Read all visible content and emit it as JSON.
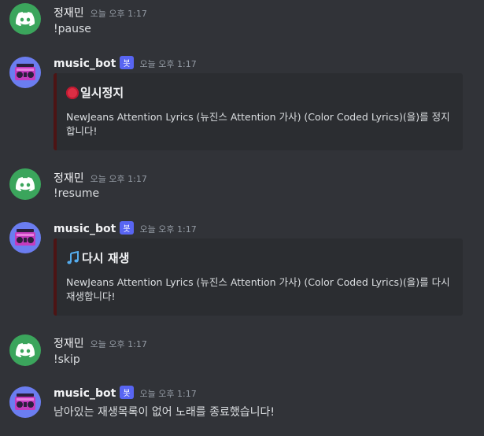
{
  "messages": [
    {
      "username": "정재민",
      "timestamp": "오늘 오후 1:17",
      "content": "!pause"
    },
    {
      "username": "music_bot",
      "bot_tag": "봇",
      "timestamp": "오늘 오후 1:17",
      "embed": {
        "title": "일시정지",
        "description": "NewJeans Attention Lyrics (뉴진스 Attention 가사) (Color Coded Lyrics)(을)를 정지합니다!"
      }
    },
    {
      "username": "정재민",
      "timestamp": "오늘 오후 1:17",
      "content": "!resume"
    },
    {
      "username": "music_bot",
      "bot_tag": "봇",
      "timestamp": "오늘 오후 1:17",
      "embed": {
        "title": "다시 재생",
        "description": "NewJeans Attention Lyrics (뉴진스 Attention 가사) (Color Coded Lyrics)(을)를 다시 재생합니다!"
      }
    },
    {
      "username": "정재민",
      "timestamp": "오늘 오후 1:17",
      "content": "!skip"
    },
    {
      "username": "music_bot",
      "bot_tag": "봇",
      "timestamp": "오늘 오후 1:17",
      "content": "남아있는 재생목록이 없어 노래를 종료했습니다!"
    }
  ],
  "colors": {
    "background": "#313338",
    "user_avatar": "#3ba55c",
    "bot_avatar": "#6b7df0",
    "bot_tag": "#5865f2",
    "embed_background": "#2b2d31",
    "embed_border": "#4d1414"
  },
  "icons": {
    "user_avatar": "discord-logo-icon",
    "bot_avatar": "boombox-icon",
    "pause_embed": "red-circle-icon",
    "resume_embed": "music-notes-icon"
  }
}
